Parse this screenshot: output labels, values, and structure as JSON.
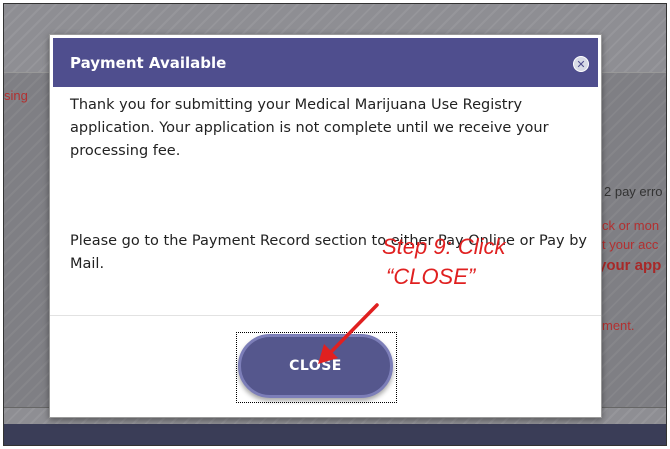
{
  "background": {
    "left_fragment": "sing",
    "right_fragments": {
      "pay_error": "2 pay erro",
      "check_money": "ck or mon",
      "your_account": "t your acc",
      "your_app": "your app",
      "payment": "ment."
    }
  },
  "modal": {
    "title": "Payment Available",
    "paragraph1": "Thank you for submitting your Medical Marijuana Use Registry application. Your application is not complete until we receive your processing fee.",
    "paragraph2": "Please go to the Payment Record section to either Pay Online or Pay by Mail.",
    "close_x_icon": "close-circle-icon",
    "close_label": "CLOSE"
  },
  "annotation": {
    "line1": "Step 9: Click",
    "line2": "“CLOSE”",
    "color": "#e02020"
  },
  "colors": {
    "header": "#4f4e8e",
    "button": "#55578d",
    "accent_red": "#b33030"
  }
}
